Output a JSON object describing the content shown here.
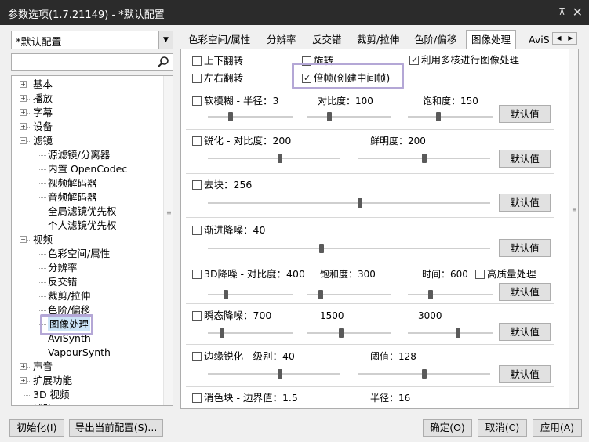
{
  "window": {
    "title": "参数选项(1.7.21149) - *默认配置",
    "pin_glyph": "⊼",
    "close_glyph": "✕"
  },
  "left": {
    "profile_value": "*默认配置",
    "search_placeholder": "",
    "tree": [
      {
        "label": "基本",
        "expander": "+"
      },
      {
        "label": "播放",
        "expander": "+"
      },
      {
        "label": "字幕",
        "expander": "+"
      },
      {
        "label": "设备",
        "expander": "+"
      },
      {
        "label": "滤镜",
        "expander": "−"
      },
      {
        "label": "源滤镜/分离器"
      },
      {
        "label": "内置 OpenCodec"
      },
      {
        "label": "视频解码器"
      },
      {
        "label": "音频解码器"
      },
      {
        "label": "全局滤镜优先权"
      },
      {
        "label": "个人滤镜优先权"
      },
      {
        "label": "视频",
        "expander": "−"
      },
      {
        "label": "色彩空间/属性"
      },
      {
        "label": "分辨率"
      },
      {
        "label": "反交错"
      },
      {
        "label": "裁剪/拉伸"
      },
      {
        "label": "色阶/偏移"
      },
      {
        "label": "图像处理"
      },
      {
        "label": "AviSynth"
      },
      {
        "label": "VapourSynth"
      },
      {
        "label": "声音",
        "expander": "+"
      },
      {
        "label": "扩展功能",
        "expander": "+"
      },
      {
        "label": "3D 视频"
      },
      {
        "label": "辅助"
      }
    ]
  },
  "tabs": [
    "色彩空间/属性",
    "分辨率",
    "反交错",
    "裁剪/拉伸",
    "色阶/偏移",
    "图像处理",
    "AviS"
  ],
  "tab_nav": {
    "prev": "◀",
    "next": "▶"
  },
  "options": {
    "flip_v": {
      "label": "上下翻转",
      "checked": false
    },
    "flip_h": {
      "label": "左右翻转",
      "checked": false
    },
    "rotate": {
      "label": "旋转",
      "checked": false
    },
    "double_frame": {
      "label": "倍帧(创建中间帧)",
      "checked": true
    },
    "multicore": {
      "label": "利用多核进行图像处理",
      "checked": true
    }
  },
  "sections": {
    "soft_blur": {
      "label": "软模糊 - 半径：3",
      "contrast": "对比度：100",
      "saturation": "饱和度：150",
      "checked": false
    },
    "sharpen": {
      "label": "锐化 - 对比度：200",
      "vivid": "鲜明度：200",
      "checked": false
    },
    "deblock": {
      "label": "去块：256",
      "checked": false
    },
    "progressive_denoise": {
      "label": "渐进降噪：40",
      "checked": false
    },
    "denoise_3d": {
      "label": "3D降噪 - 对比度：400",
      "saturation": "饱和度：300",
      "time": "时间：600",
      "hq_label": "高质量处理",
      "checked": false,
      "hq_checked": false
    },
    "instant_denoise": {
      "label": "瞬态降噪：700",
      "v2": "1500",
      "v3": "3000",
      "checked": false
    },
    "edge_sharpen": {
      "label": "边缘锐化 - 级别：40",
      "threshold": "阈值：128",
      "checked": false
    },
    "color_block": {
      "label": "消色块 - 边界值：1.5",
      "radius": "半径：16",
      "checked": false
    }
  },
  "sliders": {
    "soft_blur_radius": 0.25,
    "soft_blur_contrast": 0.25,
    "soft_blur_saturation": 0.35,
    "sharpen_contrast": 0.55,
    "sharpen_vivid": 0.5,
    "deblock": 0.54,
    "progressive_denoise": 0.4,
    "denoise_3d_contrast": 0.2,
    "denoise_3d_saturation": 0.15,
    "denoise_3d_time": 0.25,
    "instant_1": 0.15,
    "instant_2": 0.4,
    "instant_3": 0.6,
    "edge_level": 0.55,
    "edge_threshold": 0.5
  },
  "default_button": "默认值",
  "bottom": {
    "init": "初始化(I)",
    "export": "导出当前配置(S)...",
    "ok": "确定(O)",
    "cancel": "取消(C)",
    "apply": "应用(A)"
  }
}
